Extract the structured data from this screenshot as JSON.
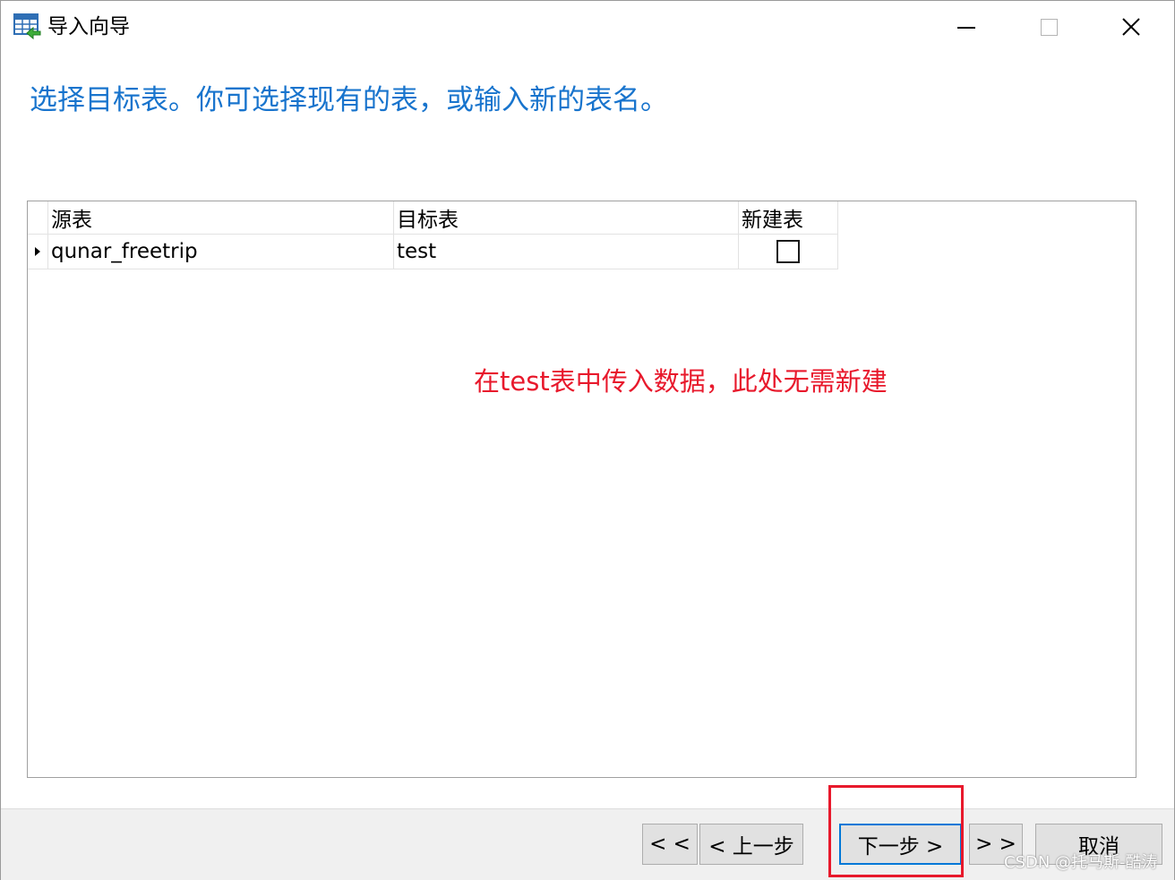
{
  "window": {
    "title": "导入向导",
    "icon": "table-import-icon"
  },
  "heading": "选择目标表。你可选择现有的表，或输入新的表名。",
  "grid": {
    "columns": [
      "源表",
      "目标表",
      "新建表"
    ],
    "rows": [
      {
        "source": "qunar_freetrip",
        "target": "test",
        "create_new": false
      }
    ]
  },
  "annotation": "在test表中传入数据，此处无需新建",
  "footer": {
    "first_label": "< <",
    "prev_label": "< 上一步",
    "next_label": "下一步 >",
    "last_label": "> >",
    "cancel_label": "取消"
  },
  "watermark": "CSDN @托马斯-酷涛",
  "colors": {
    "heading": "#1874cd",
    "annotation": "#e8192c",
    "highlight": "#e8192c",
    "focus": "#0078d7"
  }
}
